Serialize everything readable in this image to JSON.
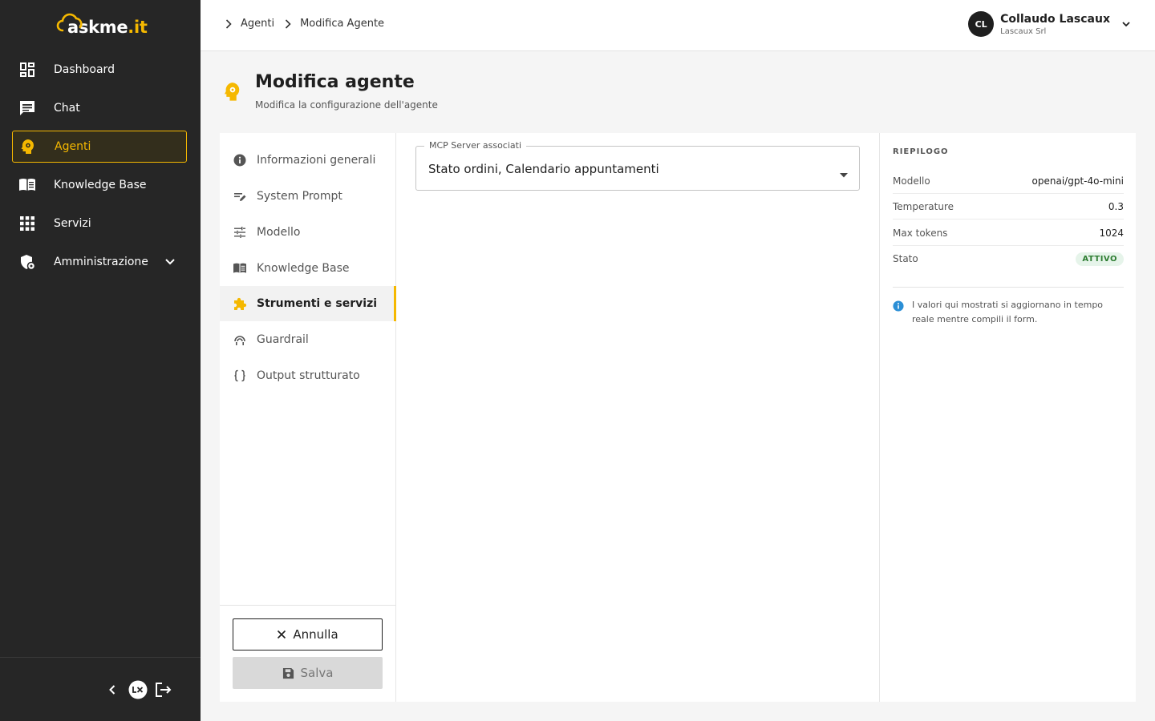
{
  "brand": {
    "name": "askme",
    "tld": ".it",
    "accent": "#f5b800"
  },
  "sidebar": {
    "items": [
      {
        "label": "Dashboard",
        "icon": "dashboard-icon"
      },
      {
        "label": "Chat",
        "icon": "chat-icon"
      },
      {
        "label": "Agenti",
        "icon": "agent-head-icon",
        "active": true
      },
      {
        "label": "Knowledge Base",
        "icon": "book-icon"
      },
      {
        "label": "Servizi",
        "icon": "grid-icon"
      },
      {
        "label": "Amministrazione",
        "icon": "admin-shield-icon",
        "expandable": true
      }
    ],
    "bottom": {
      "collapse": "chevron-left-icon",
      "lx_logo": "Lx",
      "logout": "logout-icon"
    }
  },
  "breadcrumb": [
    "Agenti",
    "Modifica Agente"
  ],
  "user": {
    "initials": "CL",
    "name": "Collaudo Lascaux",
    "org": "Lascaux Srl"
  },
  "page": {
    "title": "Modifica agente",
    "subtitle": "Modifica la configurazione dell'agente"
  },
  "tabs": [
    {
      "label": "Informazioni generali",
      "icon": "info-icon"
    },
    {
      "label": "System Prompt",
      "icon": "edit-lines-icon"
    },
    {
      "label": "Modello",
      "icon": "tune-icon"
    },
    {
      "label": "Knowledge Base",
      "icon": "book-icon"
    },
    {
      "label": "Strumenti e servizi",
      "icon": "puzzle-icon",
      "active": true
    },
    {
      "label": "Guardrail",
      "icon": "guardrail-icon"
    },
    {
      "label": "Output strutturato",
      "icon": "braces-icon"
    }
  ],
  "actions": {
    "cancel": "Annulla",
    "save": "Salva"
  },
  "form": {
    "mcp_label": "MCP Server associati",
    "mcp_value": "Stato ordini, Calendario appuntamenti"
  },
  "summary": {
    "title": "RIEPILOGO",
    "rows": [
      {
        "key": "Modello",
        "value": "openai/gpt-4o-mini"
      },
      {
        "key": "Temperature",
        "value": "0.3"
      },
      {
        "key": "Max tokens",
        "value": "1024"
      },
      {
        "key": "Stato",
        "value": "ATTIVO"
      }
    ],
    "note": "I valori qui mostrati si aggiornano in tempo reale mentre compili il form."
  }
}
